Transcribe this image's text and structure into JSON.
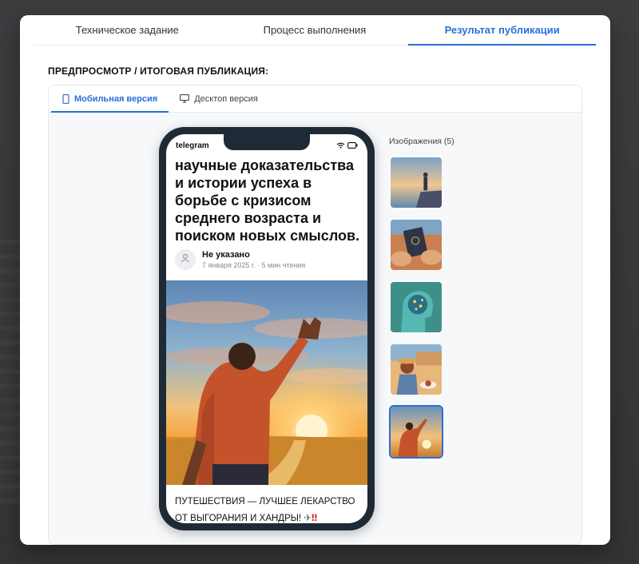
{
  "tabs": [
    {
      "label": "Техническое задание",
      "active": false
    },
    {
      "label": "Процесс выполнения",
      "active": false
    },
    {
      "label": "Результат публикации",
      "active": true
    }
  ],
  "section_title": "ПРЕДПРОСМОТР / ИТОГОВАЯ ПУБЛИКАЦИЯ:",
  "view_tabs": [
    {
      "label": "Мобильная версия",
      "icon": "phone-icon",
      "active": true
    },
    {
      "label": "Десктоп версия",
      "icon": "monitor-icon",
      "active": false
    }
  ],
  "phone": {
    "app_name": "telegram",
    "headline": "научные доказательства и истории успеха в борьбе с кризисом среднего возраста и поиском новых смыслов.",
    "author": {
      "name": "Не указано",
      "meta": "7 января 2025 г. · 5 мин чтения"
    },
    "caption_text": "ПУТЕШЕСТВИЯ — ЛУЧШЕЕ ЛЕКАРСТВО ОТ ВЫГОРАНИЯ И ХАНДРЫ! ",
    "caption_emoji": "✈",
    "caption_bang": "‼"
  },
  "images": {
    "label": "Изображения (5)",
    "items": [
      {
        "name": "person-on-cliff-sea-thumbnail",
        "selected": false
      },
      {
        "name": "passport-in-hands-thumbnail",
        "selected": false
      },
      {
        "name": "glowing-brain-head-thumbnail",
        "selected": false
      },
      {
        "name": "cafe-by-sea-thumbnail",
        "selected": false
      },
      {
        "name": "man-waving-at-sunset-thumbnail",
        "selected": true
      }
    ]
  },
  "colors": {
    "accent": "#2b6fd6",
    "phone_frame": "#1f2a37"
  }
}
